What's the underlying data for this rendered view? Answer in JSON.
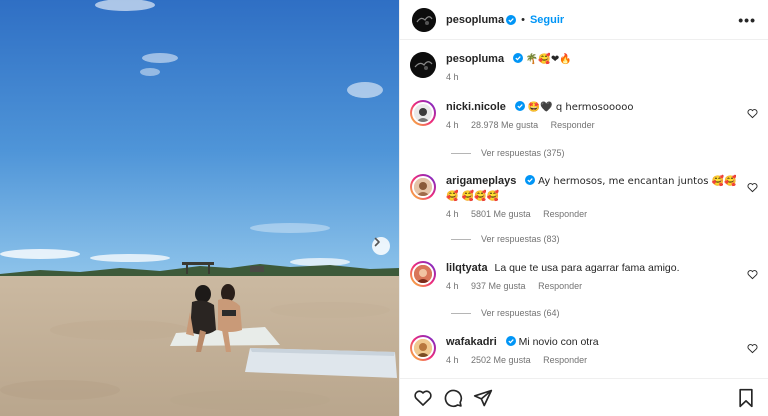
{
  "post": {
    "author": "pesopluma",
    "follow_label": "Seguir",
    "more_label": "•••",
    "caption_emojis": "🌴🥰❤🔥",
    "caption_time": "4 h",
    "next_label": "›"
  },
  "comments": [
    {
      "username": "nicki.nicole",
      "verified": true,
      "text": "🤩🖤 q hermosooooo",
      "time": "4 h",
      "likes": "28.978 Me gusta",
      "reply_label": "Responder",
      "view_replies": "Ver respuestas (375)"
    },
    {
      "username": "arigameplays",
      "verified": true,
      "text": "Ay hermosos, me encantan juntos 🥰🥰🥰 🥰🥰🥰",
      "time": "4 h",
      "likes": "5801 Me gusta",
      "reply_label": "Responder",
      "view_replies": "Ver respuestas (83)"
    },
    {
      "username": "lilqtyata",
      "verified": false,
      "text": "La que te usa para agarrar fama amigo.",
      "time": "4 h",
      "likes": "937 Me gusta",
      "reply_label": "Responder",
      "view_replies": "Ver respuestas (64)"
    },
    {
      "username": "wafakadri",
      "verified": true,
      "text": "Mi novio con otra",
      "time": "4 h",
      "likes": "2502 Me gusta",
      "reply_label": "Responder"
    }
  ],
  "icons": {
    "verified_color": "#0095f6",
    "follow_color": "#0095f6",
    "actions": [
      "heart-icon",
      "comment-icon",
      "share-icon",
      "bookmark-icon"
    ]
  }
}
